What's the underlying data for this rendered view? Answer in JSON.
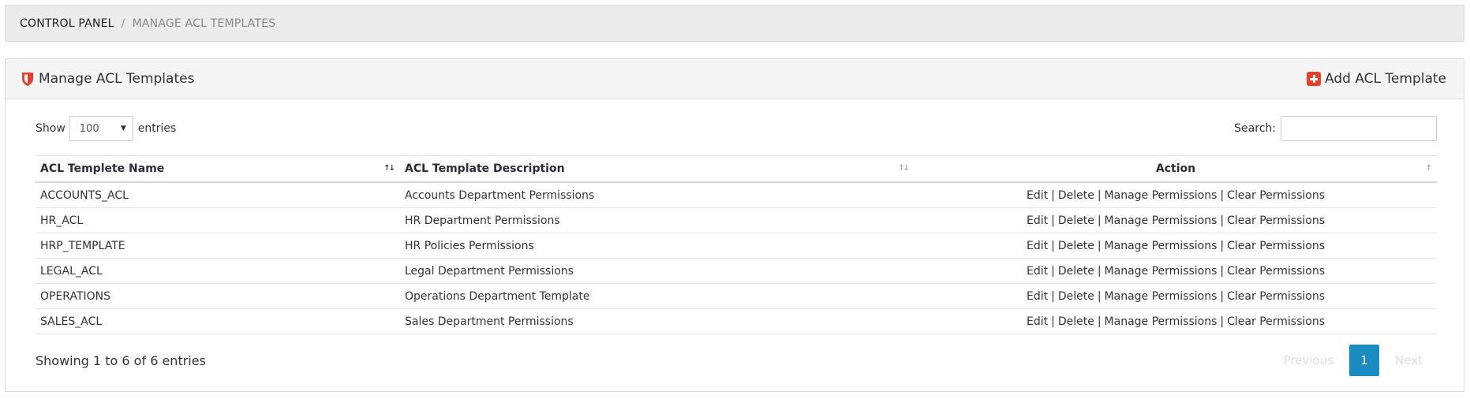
{
  "breadcrumb": {
    "root": "CONTROL PANEL",
    "separator": "/",
    "current": "MANAGE ACL TEMPLATES"
  },
  "panel": {
    "title": "Manage ACL Templates",
    "title_icon": "shield-icon",
    "add_button_label": "Add ACL Template",
    "add_button_icon": "plus-square-icon",
    "accent_color": "#e8402a"
  },
  "length_menu": {
    "show_label": "Show",
    "selected": "100",
    "entries_label": "entries"
  },
  "search": {
    "label": "Search:",
    "value": ""
  },
  "table": {
    "columns": [
      "ACL Templete Name",
      "ACL Template Description",
      "Action"
    ],
    "actions": [
      "Edit",
      "Delete",
      "Manage Permissions",
      "Clear Permissions"
    ],
    "action_separator": "|",
    "rows": [
      {
        "name": "ACCOUNTS_ACL",
        "description": "Accounts Department Permissions"
      },
      {
        "name": "HR_ACL",
        "description": "HR Department Permissions"
      },
      {
        "name": "HRP_TEMPLATE",
        "description": "HR Policies Permissions"
      },
      {
        "name": "LEGAL_ACL",
        "description": "Legal Department Permissions"
      },
      {
        "name": "OPERATIONS",
        "description": "Operations Department Template"
      },
      {
        "name": "SALES_ACL",
        "description": "Sales Department Permissions"
      }
    ]
  },
  "footer": {
    "info": "Showing 1 to 6 of 6 entries",
    "previous": "Previous",
    "current_page": "1",
    "next": "Next",
    "page_color": "#1a8cc2"
  }
}
